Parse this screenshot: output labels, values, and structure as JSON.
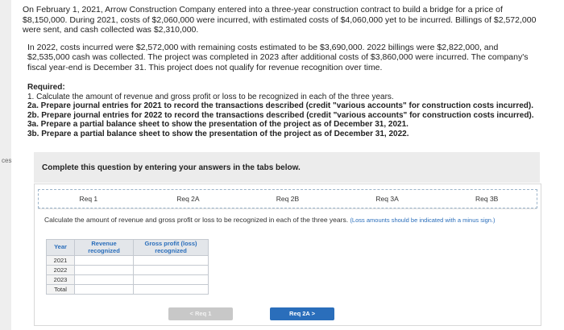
{
  "side_label": "ces",
  "problem": {
    "paragraph1": "On February 1, 2021, Arrow Construction Company entered into a three-year construction contract to build a bridge for a price of $8,150,000. During 2021, costs of $2,060,000 were incurred, with estimated costs of $4,060,000 yet to be incurred. Billings of $2,572,000 were sent, and cash collected was $2,310,000.",
    "paragraph2": "In 2022, costs incurred were $2,572,000 with remaining costs estimated to be $3,690,000. 2022 billings were $2,822,000, and $2,535,000 cash was collected. The project was completed in 2023 after additional costs of $3,860,000 were incurred. The company's fiscal year-end is December 31. This project does not qualify for revenue recognition over time."
  },
  "required": {
    "heading": "Required:",
    "items": [
      "1. Calculate the amount of revenue and gross profit or loss to be recognized in each of the three years.",
      "2a. Prepare journal entries for 2021 to record the transactions described (credit \"various accounts\" for construction costs incurred).",
      "2b. Prepare journal entries for 2022 to record the transactions described (credit \"various accounts\" for construction costs incurred).",
      "3a. Prepare a partial balance sheet to show the presentation of the project as of December 31, 2021.",
      "3b. Prepare a partial balance sheet to show the presentation of the project as of December 31, 2022."
    ]
  },
  "instruction_banner": "Complete this question by entering your answers in the tabs below.",
  "tabs": [
    "Req 1",
    "Req 2A",
    "Req 2B",
    "Req 3A",
    "Req 3B"
  ],
  "panel": {
    "instruction": "Calculate the amount of revenue and gross profit or loss to be recognized in each of the three years.",
    "note": "(Loss amounts should be indicated with a minus sign.)"
  },
  "table": {
    "headers": [
      "Year",
      "Revenue recognized",
      "Gross profit (loss) recognized"
    ],
    "rows": [
      "2021",
      "2022",
      "2023",
      "Total"
    ]
  },
  "nav": {
    "prev_label": "< Req 1",
    "next_label": "Req 2A >"
  }
}
